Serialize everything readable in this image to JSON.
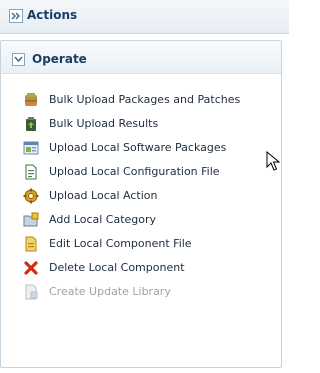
{
  "header": {
    "title": "Actions"
  },
  "section": {
    "title": "Operate",
    "items": [
      {
        "label": "Bulk Upload Packages and Patches",
        "icon": "bulk-upload-icon",
        "enabled": true
      },
      {
        "label": "Bulk Upload Results",
        "icon": "upload-results-icon",
        "enabled": true
      },
      {
        "label": "Upload Local Software Packages",
        "icon": "software-package-icon",
        "enabled": true
      },
      {
        "label": "Upload Local Configuration File",
        "icon": "configuration-file-icon",
        "enabled": true
      },
      {
        "label": "Upload Local Action",
        "icon": "gear-icon",
        "enabled": true
      },
      {
        "label": "Add Local Category",
        "icon": "add-folder-icon",
        "enabled": true
      },
      {
        "label": "Edit Local Component File",
        "icon": "edit-file-icon",
        "enabled": true
      },
      {
        "label": "Delete Local Component",
        "icon": "delete-x-icon",
        "enabled": true
      },
      {
        "label": "Create Update Library",
        "icon": "library-icon",
        "enabled": false
      }
    ]
  },
  "colors": {
    "accent": "#1a3d67",
    "delete": "#d62a12",
    "disabled": "#9aa3ab"
  }
}
